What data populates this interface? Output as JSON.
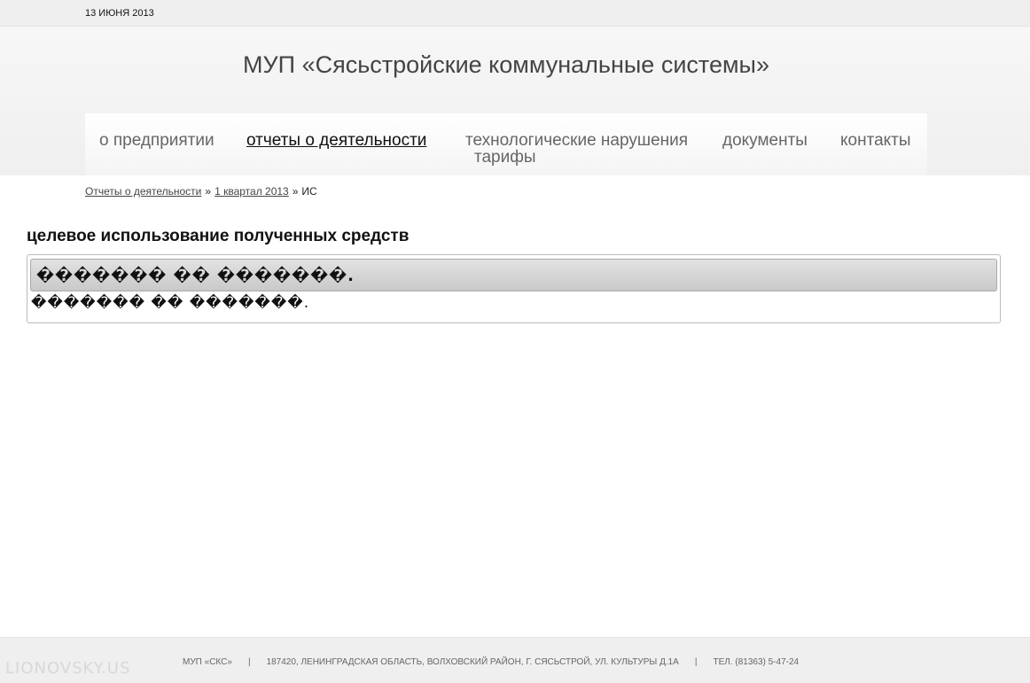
{
  "header": {
    "date": "13 ИЮНЯ 2013",
    "site_title": "МУП «Сясьстройские коммунальные системы»"
  },
  "nav": {
    "items": [
      {
        "label": "о предприятии"
      },
      {
        "label": "отчеты о деятельности",
        "active": true
      },
      {
        "label": "технологические нарушения"
      },
      {
        "label": "документы"
      },
      {
        "label": "контакты"
      },
      {
        "label": "тарифы"
      }
    ]
  },
  "breadcrumb": {
    "items": [
      "Отчеты о деятельности",
      "1 квартал 2013"
    ],
    "current": "ИС",
    "separator": "»"
  },
  "content": {
    "heading": "целевое использование полученных средств",
    "box_header": "������� �� �������.",
    "box_body": "������� �� �������."
  },
  "footer": {
    "org": "МУП «СКС»",
    "address": "187420, ЛЕНИНГРАДСКАЯ ОБЛАСТЬ, ВОЛХОВСКИЙ РАЙОН, Г. СЯСЬСТРОЙ, УЛ. КУЛЬТУРЫ Д.1А",
    "phone": "ТЕЛ. (81363) 5-47-24",
    "separator": "|",
    "watermark": "LIONOVSKY.US"
  }
}
